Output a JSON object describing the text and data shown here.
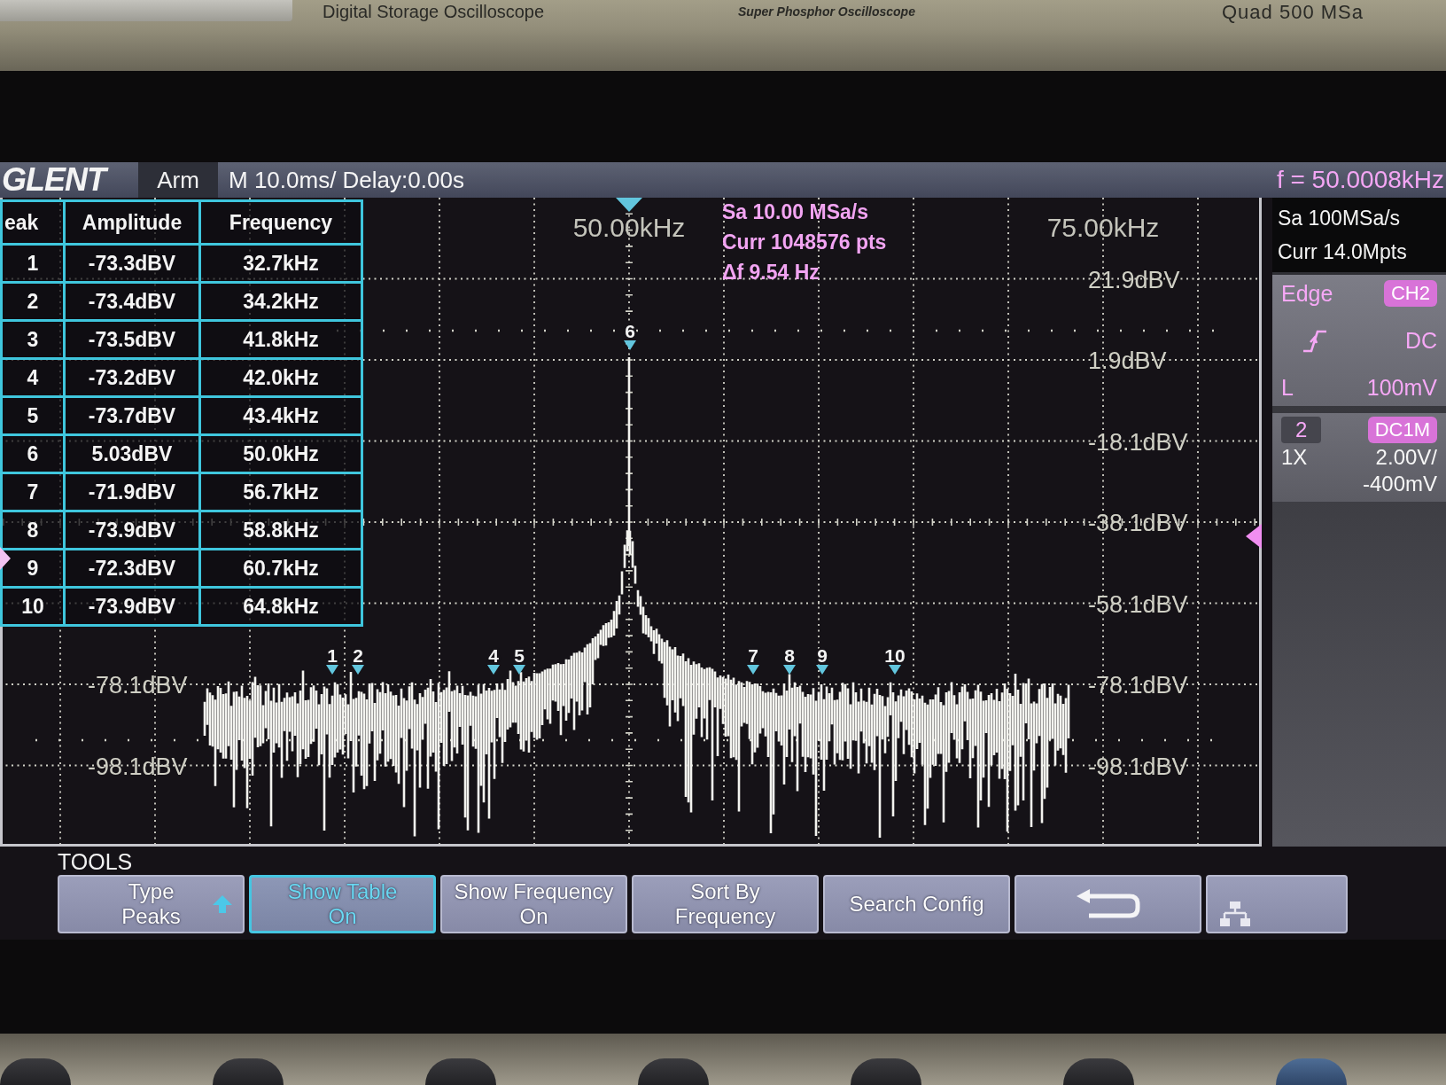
{
  "bezel": {
    "subtitle": "Digital Storage Oscilloscope",
    "tagline": "Super Phosphor Oscilloscope",
    "spec": "Quad 500 MSa"
  },
  "top_bar": {
    "logo": "GLENT",
    "trigger_status": "Arm",
    "timebase": "M 10.0ms/ Delay:0.00s",
    "frequency_counter": "f = 50.0008kHz"
  },
  "peak_table": {
    "columns": [
      "eak",
      "Amplitude",
      "Frequency"
    ],
    "rows": [
      [
        "1",
        "-73.3dBV",
        "32.7kHz"
      ],
      [
        "2",
        "-73.4dBV",
        "34.2kHz"
      ],
      [
        "3",
        "-73.5dBV",
        "41.8kHz"
      ],
      [
        "4",
        "-73.2dBV",
        "42.0kHz"
      ],
      [
        "5",
        "-73.7dBV",
        "43.4kHz"
      ],
      [
        "6",
        "5.03dBV",
        "50.0kHz"
      ],
      [
        "7",
        "-71.9dBV",
        "56.7kHz"
      ],
      [
        "8",
        "-73.9dBV",
        "58.8kHz"
      ],
      [
        "9",
        "-72.3dBV",
        "60.7kHz"
      ],
      [
        "10",
        "-73.9dBV",
        "64.8kHz"
      ]
    ]
  },
  "spectrum": {
    "center_frequency": "50.00kHz",
    "right_frequency": "75.00kHz",
    "info": [
      "Sa 10.00 MSa/s",
      "Curr 1048576 pts",
      "Δf 9.54 Hz"
    ],
    "levels_right": [
      "21.9dBV",
      "1.9dBV",
      "-18.1dBV",
      "-38.1dBV",
      "-58.1dBV",
      "-78.1dBV",
      "-98.1dBV"
    ],
    "levels_left": [
      "-78.1dBV",
      "-98.1dBV"
    ],
    "peak_markers": [
      "1",
      "2",
      "4",
      "5",
      "6",
      "7",
      "8",
      "9",
      "10"
    ]
  },
  "acquisition": {
    "sample_rate": "Sa 100MSa/s",
    "memory": "Curr 14.0Mpts"
  },
  "trigger": {
    "type": "Edge",
    "source": "CH2",
    "coupling": "DC",
    "level_label": "L",
    "level_value": "100mV"
  },
  "channel": {
    "number": "2",
    "coupling": "DC1M",
    "probe": "1X",
    "scale": "2.00V/",
    "offset": "-400mV"
  },
  "tools": {
    "title": "TOOLS",
    "buttons": [
      {
        "kind": "menu",
        "label": "Type",
        "value": "Peaks",
        "selected": false
      },
      {
        "kind": "option",
        "label": "Show Table",
        "value": "On",
        "selected": true
      },
      {
        "kind": "option",
        "label": "Show Frequency",
        "value": "On",
        "selected": false
      },
      {
        "kind": "option",
        "label": "Sort By",
        "value": "Frequency",
        "selected": false
      },
      {
        "kind": "action",
        "label": "Search Config",
        "selected": false
      },
      {
        "kind": "back",
        "selected": false
      },
      {
        "kind": "network",
        "selected": false
      }
    ]
  }
}
